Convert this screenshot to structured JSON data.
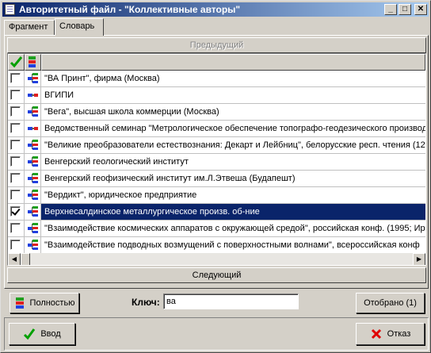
{
  "window": {
    "title": "Авторитетный файл - \"Коллективные авторы\"",
    "minimize_glyph": "_",
    "maximize_glyph": "□",
    "close_glyph": "✕"
  },
  "tabs": [
    {
      "label": "Фрагмент",
      "active": false
    },
    {
      "label": "Словарь",
      "active": true
    }
  ],
  "grid": {
    "prev_label": "Предыдущий",
    "next_label": "Следующий",
    "header_icons": [
      "check-icon",
      "tree-icon"
    ],
    "rows": [
      {
        "checked": false,
        "icon": "tree-icon",
        "text": "\"ВА Принт\", фирма (Москва)",
        "selected": false
      },
      {
        "checked": false,
        "icon": "link-icon",
        "text": "ВГИПИ",
        "selected": false
      },
      {
        "checked": false,
        "icon": "tree-icon",
        "text": "\"Вега\", высшая школа коммерции (Москва)",
        "selected": false
      },
      {
        "checked": false,
        "icon": "link-icon",
        "text": "Ведомственный семинар \"Метрологическое обеспечение топографо-геодезического производ",
        "selected": false
      },
      {
        "checked": false,
        "icon": "tree-icon",
        "text": "\"Великие преобразователи естествознания: Декарт и Лейбниц\", белорусские респ. чтения (12",
        "selected": false
      },
      {
        "checked": false,
        "icon": "tree-icon",
        "text": "Венгерский геологический институт",
        "selected": false
      },
      {
        "checked": false,
        "icon": "tree-icon",
        "text": "Венгерский геофизический институт им.Л.Этвеша (Будапешт)",
        "selected": false
      },
      {
        "checked": false,
        "icon": "tree-icon",
        "text": "\"Вердикт\", юридическое предприятие",
        "selected": false
      },
      {
        "checked": true,
        "icon": "tree-icon",
        "text": "Верхнесалдинское металлургическое произв. об-ние",
        "selected": true
      },
      {
        "checked": false,
        "icon": "tree-icon",
        "text": "\"Взаимодействие космических аппаратов с окружающей средой\", российская конф. (1995; Ир",
        "selected": false
      },
      {
        "checked": false,
        "icon": "tree-icon",
        "text": "\"Взаимодействие подводных возмущений с поверхностными волнами\", всероссийская конф",
        "selected": false
      }
    ]
  },
  "search": {
    "key_label": "Ключ:",
    "value": "ва"
  },
  "buttons": {
    "full_label": "Полностью",
    "selected_label": "Отобрано (1)",
    "ok_label": "Ввод",
    "cancel_label": "Отказ"
  },
  "colors": {
    "titlebar_start": "#0a246a",
    "titlebar_end": "#a6caf0",
    "selection": "#0a246a",
    "ok_check": "#00a000",
    "cancel_x": "#e00000"
  }
}
